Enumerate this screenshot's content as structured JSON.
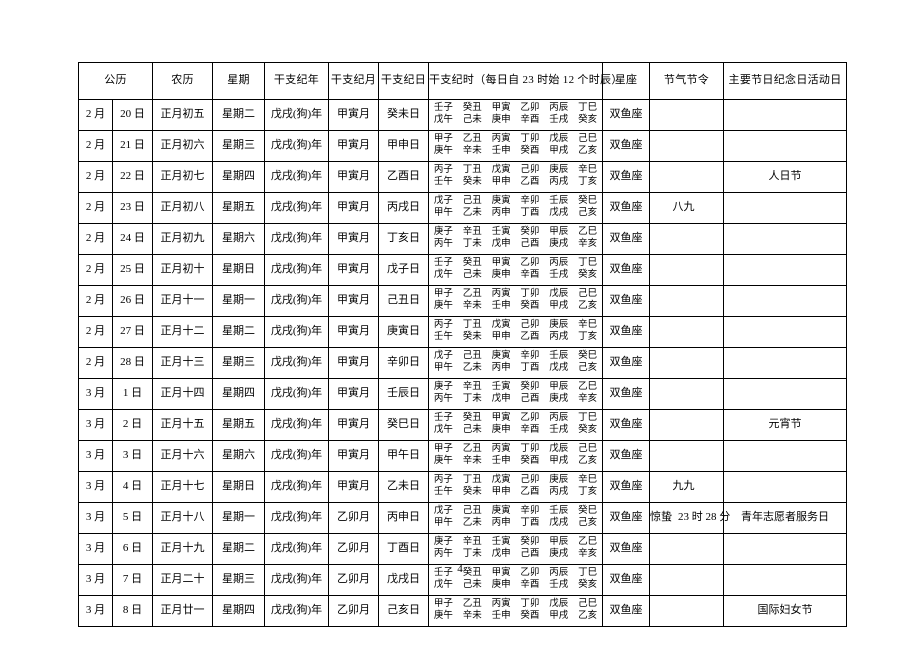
{
  "page": {
    "number": "4"
  },
  "table": {
    "headers": {
      "solar": "公历",
      "lunar": "农历",
      "weekday": "星期",
      "ganzhi_year": "干支纪年",
      "ganzhi_month": "干支纪月",
      "ganzhi_day": "干支纪日",
      "ganzhi_hour": "干支纪时（每日自 23 时始 12 个时辰）",
      "zodiac": "星座",
      "solar_term": "节气节令",
      "festival": "主要节日纪念日活动日"
    },
    "rows": [
      {
        "solar_month": "2 月",
        "solar_day": "20 日",
        "lunar": "正月初五",
        "weekday": "星期二",
        "gz_year": "戊戌(狗)年",
        "gz_month": "甲寅月",
        "gz_day": "癸未日",
        "gz_hours": [
          "壬子",
          "癸丑",
          "甲寅",
          "乙卯",
          "丙辰",
          "丁巳",
          "戊午",
          "己未",
          "庚申",
          "辛酉",
          "壬戌",
          "癸亥"
        ],
        "zodiac": "双鱼座",
        "solar_term": "",
        "solar_term_time": "",
        "festival": ""
      },
      {
        "solar_month": "2 月",
        "solar_day": "21 日",
        "lunar": "正月初六",
        "weekday": "星期三",
        "gz_year": "戊戌(狗)年",
        "gz_month": "甲寅月",
        "gz_day": "甲申日",
        "gz_hours": [
          "甲子",
          "乙丑",
          "丙寅",
          "丁卯",
          "戊辰",
          "己巳",
          "庚午",
          "辛未",
          "壬申",
          "癸酉",
          "甲戌",
          "乙亥"
        ],
        "zodiac": "双鱼座",
        "solar_term": "",
        "solar_term_time": "",
        "festival": ""
      },
      {
        "solar_month": "2 月",
        "solar_day": "22 日",
        "lunar": "正月初七",
        "weekday": "星期四",
        "gz_year": "戊戌(狗)年",
        "gz_month": "甲寅月",
        "gz_day": "乙酉日",
        "gz_hours": [
          "丙子",
          "丁丑",
          "戊寅",
          "己卯",
          "庚辰",
          "辛巳",
          "壬午",
          "癸未",
          "甲申",
          "乙酉",
          "丙戌",
          "丁亥"
        ],
        "zodiac": "双鱼座",
        "solar_term": "",
        "solar_term_time": "",
        "festival": "人日节"
      },
      {
        "solar_month": "2 月",
        "solar_day": "23 日",
        "lunar": "正月初八",
        "weekday": "星期五",
        "gz_year": "戊戌(狗)年",
        "gz_month": "甲寅月",
        "gz_day": "丙戌日",
        "gz_hours": [
          "戊子",
          "己丑",
          "庚寅",
          "辛卯",
          "壬辰",
          "癸巳",
          "甲午",
          "乙未",
          "丙申",
          "丁酉",
          "戊戌",
          "己亥"
        ],
        "zodiac": "双鱼座",
        "solar_term": "八九",
        "solar_term_time": "",
        "festival": ""
      },
      {
        "solar_month": "2 月",
        "solar_day": "24 日",
        "lunar": "正月初九",
        "weekday": "星期六",
        "gz_year": "戊戌(狗)年",
        "gz_month": "甲寅月",
        "gz_day": "丁亥日",
        "gz_hours": [
          "庚子",
          "辛丑",
          "壬寅",
          "癸卯",
          "甲辰",
          "乙巳",
          "丙午",
          "丁未",
          "戊申",
          "己酉",
          "庚戌",
          "辛亥"
        ],
        "zodiac": "双鱼座",
        "solar_term": "",
        "solar_term_time": "",
        "festival": ""
      },
      {
        "solar_month": "2 月",
        "solar_day": "25 日",
        "lunar": "正月初十",
        "weekday": "星期日",
        "gz_year": "戊戌(狗)年",
        "gz_month": "甲寅月",
        "gz_day": "戊子日",
        "gz_hours": [
          "壬子",
          "癸丑",
          "甲寅",
          "乙卯",
          "丙辰",
          "丁巳",
          "戊午",
          "己未",
          "庚申",
          "辛酉",
          "壬戌",
          "癸亥"
        ],
        "zodiac": "双鱼座",
        "solar_term": "",
        "solar_term_time": "",
        "festival": ""
      },
      {
        "solar_month": "2 月",
        "solar_day": "26 日",
        "lunar": "正月十一",
        "weekday": "星期一",
        "gz_year": "戊戌(狗)年",
        "gz_month": "甲寅月",
        "gz_day": "己丑日",
        "gz_hours": [
          "甲子",
          "乙丑",
          "丙寅",
          "丁卯",
          "戊辰",
          "己巳",
          "庚午",
          "辛未",
          "壬申",
          "癸酉",
          "甲戌",
          "乙亥"
        ],
        "zodiac": "双鱼座",
        "solar_term": "",
        "solar_term_time": "",
        "festival": ""
      },
      {
        "solar_month": "2 月",
        "solar_day": "27 日",
        "lunar": "正月十二",
        "weekday": "星期二",
        "gz_year": "戊戌(狗)年",
        "gz_month": "甲寅月",
        "gz_day": "庚寅日",
        "gz_hours": [
          "丙子",
          "丁丑",
          "戊寅",
          "己卯",
          "庚辰",
          "辛巳",
          "壬午",
          "癸未",
          "甲申",
          "乙酉",
          "丙戌",
          "丁亥"
        ],
        "zodiac": "双鱼座",
        "solar_term": "",
        "solar_term_time": "",
        "festival": ""
      },
      {
        "solar_month": "2 月",
        "solar_day": "28 日",
        "lunar": "正月十三",
        "weekday": "星期三",
        "gz_year": "戊戌(狗)年",
        "gz_month": "甲寅月",
        "gz_day": "辛卯日",
        "gz_hours": [
          "戊子",
          "己丑",
          "庚寅",
          "辛卯",
          "壬辰",
          "癸巳",
          "甲午",
          "乙未",
          "丙申",
          "丁酉",
          "戊戌",
          "己亥"
        ],
        "zodiac": "双鱼座",
        "solar_term": "",
        "solar_term_time": "",
        "festival": ""
      },
      {
        "solar_month": "3 月",
        "solar_day": "1 日",
        "lunar": "正月十四",
        "weekday": "星期四",
        "gz_year": "戊戌(狗)年",
        "gz_month": "甲寅月",
        "gz_day": "壬辰日",
        "gz_hours": [
          "庚子",
          "辛丑",
          "壬寅",
          "癸卯",
          "甲辰",
          "乙巳",
          "丙午",
          "丁未",
          "戊申",
          "己酉",
          "庚戌",
          "辛亥"
        ],
        "zodiac": "双鱼座",
        "solar_term": "",
        "solar_term_time": "",
        "festival": ""
      },
      {
        "solar_month": "3 月",
        "solar_day": "2 日",
        "lunar": "正月十五",
        "weekday": "星期五",
        "gz_year": "戊戌(狗)年",
        "gz_month": "甲寅月",
        "gz_day": "癸巳日",
        "gz_hours": [
          "壬子",
          "癸丑",
          "甲寅",
          "乙卯",
          "丙辰",
          "丁巳",
          "戊午",
          "己未",
          "庚申",
          "辛酉",
          "壬戌",
          "癸亥"
        ],
        "zodiac": "双鱼座",
        "solar_term": "",
        "solar_term_time": "",
        "festival": "元宵节"
      },
      {
        "solar_month": "3 月",
        "solar_day": "3 日",
        "lunar": "正月十六",
        "weekday": "星期六",
        "gz_year": "戊戌(狗)年",
        "gz_month": "甲寅月",
        "gz_day": "甲午日",
        "gz_hours": [
          "甲子",
          "乙丑",
          "丙寅",
          "丁卯",
          "戊辰",
          "己巳",
          "庚午",
          "辛未",
          "壬申",
          "癸酉",
          "甲戌",
          "乙亥"
        ],
        "zodiac": "双鱼座",
        "solar_term": "",
        "solar_term_time": "",
        "festival": ""
      },
      {
        "solar_month": "3 月",
        "solar_day": "4 日",
        "lunar": "正月十七",
        "weekday": "星期日",
        "gz_year": "戊戌(狗)年",
        "gz_month": "甲寅月",
        "gz_day": "乙未日",
        "gz_hours": [
          "丙子",
          "丁丑",
          "戊寅",
          "己卯",
          "庚辰",
          "辛巳",
          "壬午",
          "癸未",
          "甲申",
          "乙酉",
          "丙戌",
          "丁亥"
        ],
        "zodiac": "双鱼座",
        "solar_term": "九九",
        "solar_term_time": "",
        "festival": ""
      },
      {
        "solar_month": "3 月",
        "solar_day": "5 日",
        "lunar": "正月十八",
        "weekday": "星期一",
        "gz_year": "戊戌(狗)年",
        "gz_month": "乙卯月",
        "gz_day": "丙申日",
        "gz_hours": [
          "戊子",
          "己丑",
          "庚寅",
          "辛卯",
          "壬辰",
          "癸巳",
          "甲午",
          "乙未",
          "丙申",
          "丁酉",
          "戊戌",
          "己亥"
        ],
        "zodiac": "双鱼座",
        "solar_term": "惊蛰",
        "solar_term_time": "23 时 28 分",
        "festival": "青年志愿者服务日"
      },
      {
        "solar_month": "3 月",
        "solar_day": "6 日",
        "lunar": "正月十九",
        "weekday": "星期二",
        "gz_year": "戊戌(狗)年",
        "gz_month": "乙卯月",
        "gz_day": "丁酉日",
        "gz_hours": [
          "庚子",
          "辛丑",
          "壬寅",
          "癸卯",
          "甲辰",
          "乙巳",
          "丙午",
          "丁未",
          "戊申",
          "己酉",
          "庚戌",
          "辛亥"
        ],
        "zodiac": "双鱼座",
        "solar_term": "",
        "solar_term_time": "",
        "festival": ""
      },
      {
        "solar_month": "3 月",
        "solar_day": "7 日",
        "lunar": "正月二十",
        "weekday": "星期三",
        "gz_year": "戊戌(狗)年",
        "gz_month": "乙卯月",
        "gz_day": "戊戌日",
        "gz_hours": [
          "壬子",
          "癸丑",
          "甲寅",
          "乙卯",
          "丙辰",
          "丁巳",
          "戊午",
          "己未",
          "庚申",
          "辛酉",
          "壬戌",
          "癸亥"
        ],
        "zodiac": "双鱼座",
        "solar_term": "",
        "solar_term_time": "",
        "festival": ""
      },
      {
        "solar_month": "3 月",
        "solar_day": "8 日",
        "lunar": "正月廿一",
        "weekday": "星期四",
        "gz_year": "戊戌(狗)年",
        "gz_month": "乙卯月",
        "gz_day": "己亥日",
        "gz_hours": [
          "甲子",
          "乙丑",
          "丙寅",
          "丁卯",
          "戊辰",
          "己巳",
          "庚午",
          "辛未",
          "壬申",
          "癸酉",
          "甲戌",
          "乙亥"
        ],
        "zodiac": "双鱼座",
        "solar_term": "",
        "solar_term_time": "",
        "festival": "国际妇女节"
      }
    ]
  }
}
